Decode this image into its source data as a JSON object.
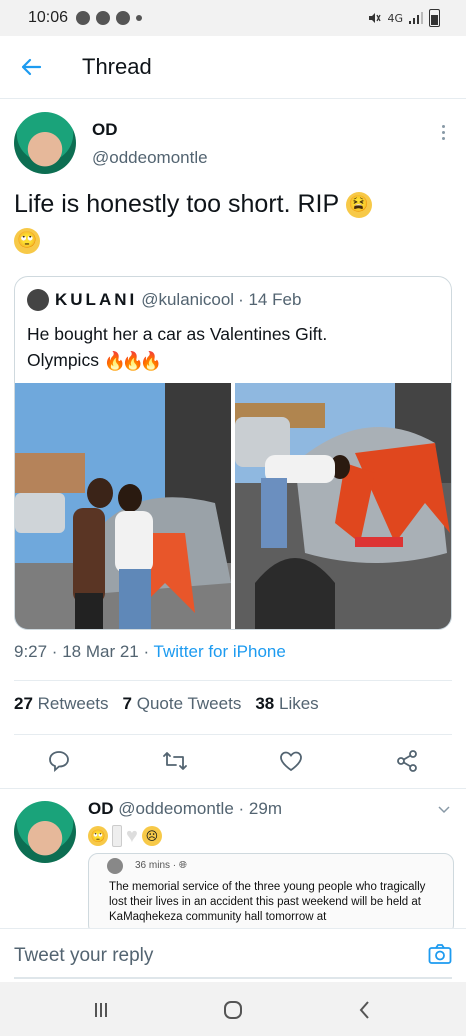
{
  "status_bar": {
    "time": "10:06",
    "network": "4G"
  },
  "header": {
    "title": "Thread"
  },
  "tweet": {
    "name": "OD",
    "handle": "@oddeomontle",
    "text": "Life is honestly too short. RIP",
    "quote": {
      "name": "KULANI",
      "handle": "@kulanicool",
      "date": "· 14 Feb",
      "text_line1": "He bought her a car as Valentines Gift.",
      "text_line2": "Olympics"
    },
    "meta": {
      "time": "9:27 · 18 Mar 21 · ",
      "source": "Twitter for iPhone"
    },
    "stats": {
      "retweets_count": "27",
      "retweets_label": "Retweets",
      "quotes_count": "7",
      "quotes_label": "Quote Tweets",
      "likes_count": "38",
      "likes_label": "Likes"
    }
  },
  "reply": {
    "name": "OD",
    "handle": "@oddeomontle",
    "time": "· 29m",
    "card_meta": "36 mins · ",
    "card_text": "The memorial service of the three young people who tragically lost their lives in an accident this past weekend will be held at KaMaqhekeza community hall tomorrow at"
  },
  "composer": {
    "placeholder": "Tweet your reply"
  },
  "colors": {
    "accent": "#1d9bf0",
    "text": "#0f1419",
    "muted": "#536471",
    "border": "#cfd9de"
  },
  "icons": [
    "back-arrow-icon",
    "more-icon",
    "reply-icon",
    "retweet-icon",
    "like-icon",
    "share-icon",
    "chevron-down-icon",
    "camera-icon",
    "recents-icon",
    "home-icon",
    "back-icon"
  ]
}
